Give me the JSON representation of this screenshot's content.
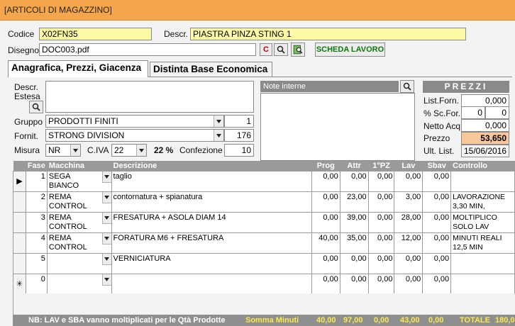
{
  "window": {
    "title": "[ARTICOLI DI MAGAZZINO]"
  },
  "header": {
    "codice_label": "Codice",
    "codice_value": "X02FN35",
    "descr_label": "Descr.",
    "descr_value": "PIASTRA PINZA STING 1",
    "disegno_label": "Disegno",
    "disegno_value": "DOC003.pdf",
    "c_button": "C",
    "scheda_button": "SCHEDA LAVORO"
  },
  "tabs": [
    {
      "label": "Anagrafica, Prezzi, Giacenza",
      "active": true
    },
    {
      "label": "Distinta Base Economica",
      "active": false
    }
  ],
  "anagrafica": {
    "descr_estesa_label_1": "Descr.",
    "descr_estesa_label_2": "Estesa",
    "descr_estesa_value": "",
    "note_label": "Note interne",
    "gruppo_label": "Gruppo",
    "gruppo_value": "PRODOTTI FINITI",
    "gruppo_code": "1",
    "fornit_label": "Fornit.",
    "fornit_value": "STRONG DIVISION",
    "fornit_code": "176",
    "misura_label": "Misura",
    "misura_value": "NR",
    "civa_label": "C.IVA",
    "civa_value": "22",
    "iva_percent": "22 %",
    "confezione_label": "Confezione",
    "confezione_value": "10"
  },
  "prezzi": {
    "header": "PREZZI",
    "list_forn_label": "List.Forn.",
    "list_forn_value": "0,000",
    "sc_for_label": "% Sc.For.",
    "sc_for_value_1": "0",
    "sc_for_value_2": "0",
    "netto_label": "Netto Acq",
    "netto_value": "0,000",
    "prezzo_label": "Prezzo",
    "prezzo_value": "53,650",
    "ult_list_label": "Ult. List.",
    "ult_list_value": "15/06/2016"
  },
  "grid": {
    "columns": [
      "Fase",
      "Macchina",
      "Descrizione",
      "Prog",
      "Attr",
      "1°PZ",
      "Lav",
      "Sbav",
      "Controllo"
    ],
    "rows": [
      {
        "fase": "1",
        "macchina": "SEGA BIANCO",
        "descrizione": "taglio",
        "prog": "0,00",
        "attr": "0,00",
        "pz": "0,00",
        "lav": "0,00",
        "sbav": "0,00",
        "controllo": ""
      },
      {
        "fase": "2",
        "macchina": "REMA CONTROL",
        "descrizione": "contornatura + spianatura",
        "prog": "0,00",
        "attr": "23,00",
        "pz": "0,00",
        "lav": "3,00",
        "sbav": "0,00",
        "controllo": "LAVORAZIONE 3,30 MIN,"
      },
      {
        "fase": "3",
        "macchina": "REMA CONTROL",
        "descrizione": "FRESATURA + ASOLA DIAM 14",
        "prog": "0,00",
        "attr": "39,00",
        "pz": "0,00",
        "lav": "28,00",
        "sbav": "0,00",
        "controllo": "MOLTIPLICO SOLO LAV"
      },
      {
        "fase": "4",
        "macchina": "REMA CONTROL",
        "descrizione": "FORATURA M6 + FRESATURA",
        "prog": "40,00",
        "attr": "35,00",
        "pz": "0,00",
        "lav": "12,00",
        "sbav": "0,00",
        "controllo": "MINUTI REALI 12,5 MIN"
      },
      {
        "fase": "5",
        "macchina": "",
        "descrizione": "VERNICIATURA",
        "prog": "0,00",
        "attr": "0,00",
        "pz": "0,00",
        "lav": "0,00",
        "sbav": "0,00",
        "controllo": ""
      },
      {
        "fase": "0",
        "macchina": "",
        "descrizione": "",
        "prog": "0,00",
        "attr": "0,00",
        "pz": "0,00",
        "lav": "0,00",
        "sbav": "0,00",
        "controllo": ""
      }
    ],
    "row_markers": [
      "▶",
      "",
      "",
      "",
      "",
      "✳"
    ]
  },
  "footer": {
    "note": "NB: LAV e SBA vanno moltiplicati per le Qtà Prodotte",
    "somma_label": "Somma Minuti",
    "sum_prog": "40,00",
    "sum_attr": "97,00",
    "sum_pz": "0,00",
    "sum_lav": "43,00",
    "sum_sbav": "0,00",
    "totale_label": "TOTALE",
    "totale_value": "180,0"
  },
  "colors": {
    "titlebar": "#f6a64a",
    "field_yellow": "#fdf9a6",
    "price_orange": "#f8c79a",
    "header_gray": "#8a8a8a",
    "footer_yellow": "#ffe94a"
  }
}
